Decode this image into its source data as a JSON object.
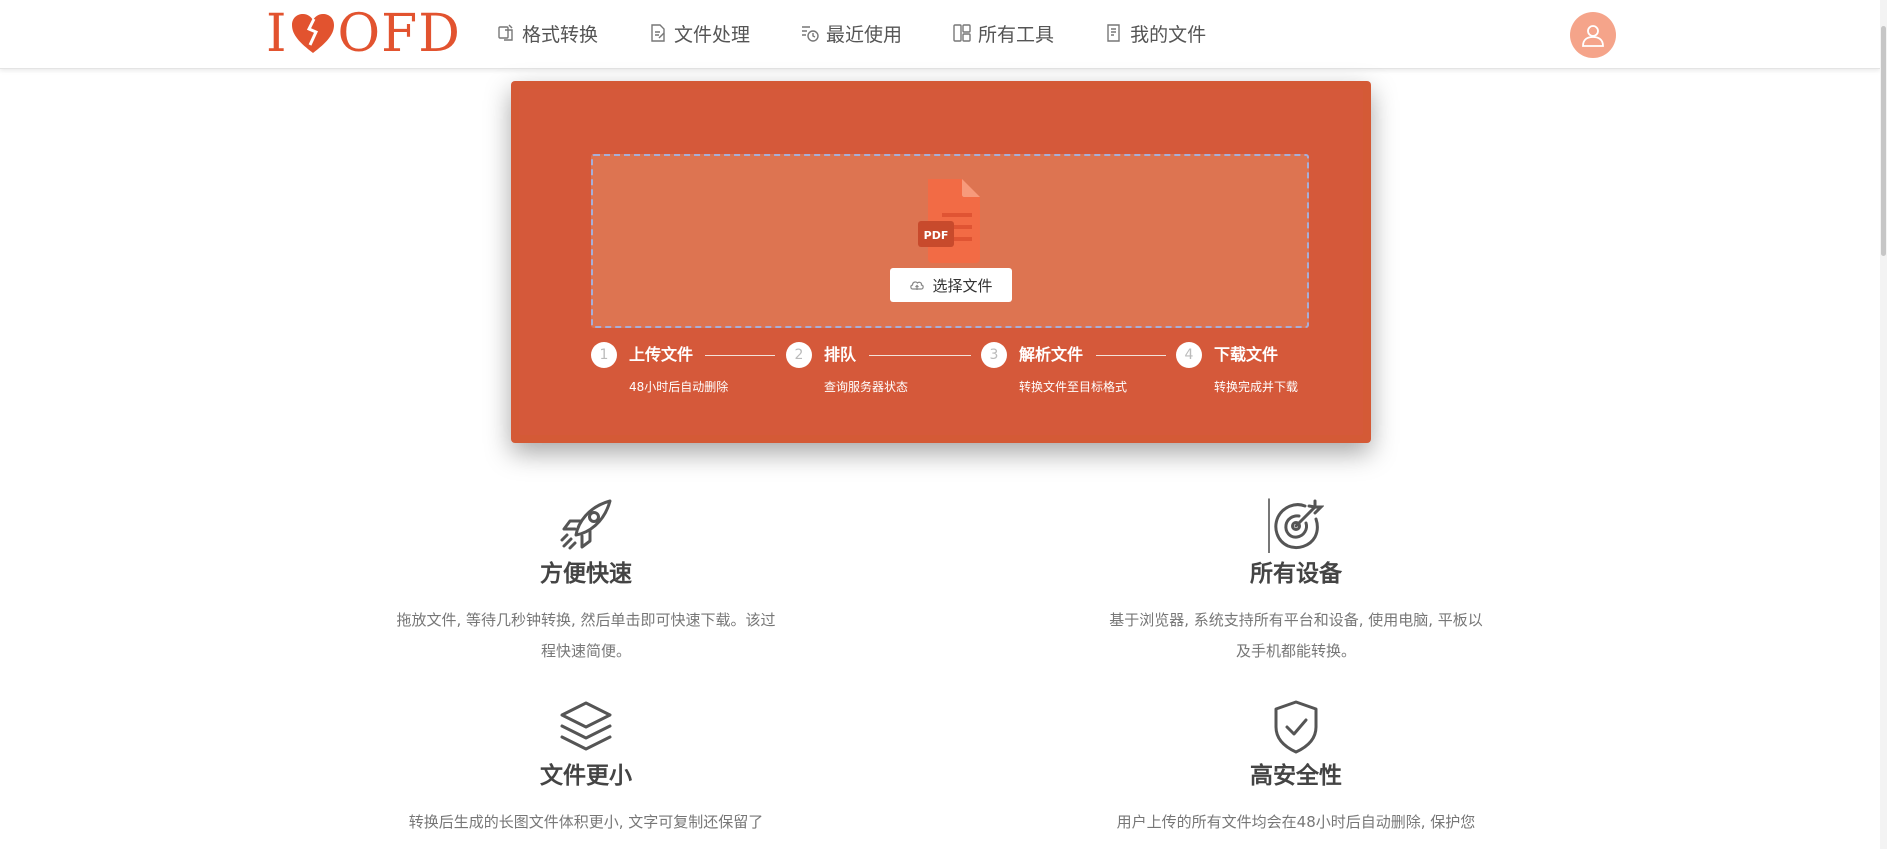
{
  "header": {
    "logo_i": "I",
    "logo_text": "OFD",
    "nav": [
      {
        "label": "格式转换",
        "icon": "convert-icon"
      },
      {
        "label": "文件处理",
        "icon": "edit-file-icon"
      },
      {
        "label": "最近使用",
        "icon": "recent-icon"
      },
      {
        "label": "所有工具",
        "icon": "grid-icon"
      },
      {
        "label": "我的文件",
        "icon": "doc-icon"
      }
    ],
    "avatar_icon": "user-icon"
  },
  "upload": {
    "file_badge": "PDF",
    "button_label": "选择文件",
    "steps": [
      {
        "num": "1",
        "title": "上传文件",
        "desc": "48小时后自动删除"
      },
      {
        "num": "2",
        "title": "排队",
        "desc": "查询服务器状态"
      },
      {
        "num": "3",
        "title": "解析文件",
        "desc": "转换文件至目标格式"
      },
      {
        "num": "4",
        "title": "下载文件",
        "desc": "转换完成并下载"
      }
    ]
  },
  "features": [
    {
      "title": "方便快速",
      "icon": "rocket-icon",
      "desc": "拖放文件, 等待几秒钟转换, 然后单击即可快速下载。该过程快速简便。"
    },
    {
      "title": "所有设备",
      "icon": "target-icon",
      "desc": "基于浏览器, 系统支持所有平台和设备, 使用电脑, 平板以及手机都能转换。"
    },
    {
      "title": "文件更小",
      "icon": "layers-icon",
      "desc": "转换后生成的长图文件体积更小, 文字可复制还保留了"
    },
    {
      "title": "高安全性",
      "icon": "shield-check-icon",
      "desc": "用户上传的所有文件均会在48小时后自动删除, 保护您"
    }
  ],
  "colors": {
    "brand": "#e2532f",
    "card": "#d45a36",
    "dropzone": "#dd7451"
  }
}
